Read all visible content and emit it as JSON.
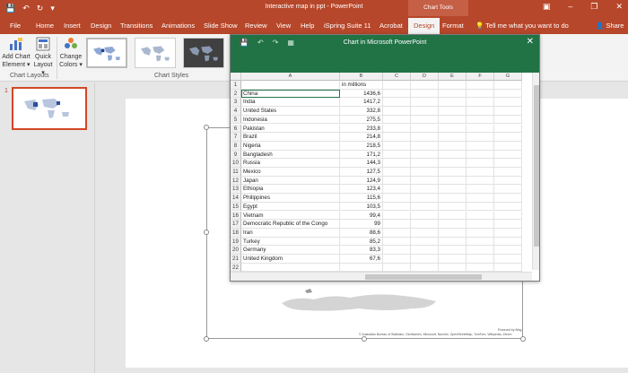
{
  "titlebar": {
    "title": "Interactive map in ppt - PowerPoint",
    "context_header": "Chart Tools"
  },
  "tabs": [
    "File",
    "Home",
    "Insert",
    "Design",
    "Transitions",
    "Animations",
    "Slide Show",
    "Review",
    "View",
    "Help",
    "iSpring Suite 11",
    "Acrobat",
    "Design",
    "Format"
  ],
  "active_tab_index": 12,
  "tell_me": "Tell me what you want to do",
  "share": "Share",
  "ribbon": {
    "add_chart_element": [
      "Add Chart",
      "Element"
    ],
    "quick_layout": [
      "Quick",
      "Layout"
    ],
    "change_colors": [
      "Change",
      "Colors"
    ],
    "group_chart_layouts": "Chart Layouts",
    "group_chart_styles": "Chart Styles"
  },
  "slide_pane": {
    "slide_number": "1"
  },
  "sheet": {
    "title": "Chart in Microsoft PowerPoint",
    "columns": [
      "A",
      "B",
      "C",
      "D",
      "E",
      "F",
      "G"
    ],
    "rows": [
      {
        "n": "1",
        "a": "",
        "b": "in millions"
      },
      {
        "n": "2",
        "a": "China",
        "b": "1436,6"
      },
      {
        "n": "3",
        "a": "India",
        "b": "1417,2"
      },
      {
        "n": "4",
        "a": "United States",
        "b": "332,8"
      },
      {
        "n": "5",
        "a": "Indonesia",
        "b": "275,5"
      },
      {
        "n": "6",
        "a": "Pakistan",
        "b": "233,8"
      },
      {
        "n": "7",
        "a": "Brazil",
        "b": "214,8"
      },
      {
        "n": "8",
        "a": "Nigeria",
        "b": "218,5"
      },
      {
        "n": "9",
        "a": "Bangladesh",
        "b": "171,2"
      },
      {
        "n": "10",
        "a": "Russia",
        "b": "144,3"
      },
      {
        "n": "11",
        "a": "Mexico",
        "b": "127,5"
      },
      {
        "n": "12",
        "a": "Japan",
        "b": "124,9"
      },
      {
        "n": "13",
        "a": "Ethiopia",
        "b": "123,4"
      },
      {
        "n": "14",
        "a": "Philippines",
        "b": "115,6"
      },
      {
        "n": "15",
        "a": "Egypt",
        "b": "103,5"
      },
      {
        "n": "16",
        "a": "Vietnam",
        "b": "99,4"
      },
      {
        "n": "17",
        "a": "Democratic Republic of the Congo",
        "b": "99"
      },
      {
        "n": "18",
        "a": "Iran",
        "b": "88,6"
      },
      {
        "n": "19",
        "a": "Turkey",
        "b": "85,2"
      },
      {
        "n": "20",
        "a": "Germany",
        "b": "83,3"
      },
      {
        "n": "21",
        "a": "United Kingdom",
        "b": "67,6"
      },
      {
        "n": "22",
        "a": "",
        "b": ""
      }
    ]
  },
  "map_credit": {
    "line1": "Powered by Bing",
    "line2": "© Australian Bureau of Statistics, GeoNames, Microsoft, Navinfo, OpenStreetMap, TomTom, Wikipedia, Zenrin"
  },
  "icons": {
    "save": "save-icon",
    "undo": "undo-icon",
    "redo": "redo-icon",
    "close": "close-icon",
    "restore": "restore-icon",
    "minimize": "minimize-icon",
    "lightbulb": "lightbulb-icon",
    "person": "person-icon"
  },
  "colors": {
    "ppt_accent": "#b7472a",
    "excel_accent": "#217346",
    "selection": "#d24726"
  }
}
